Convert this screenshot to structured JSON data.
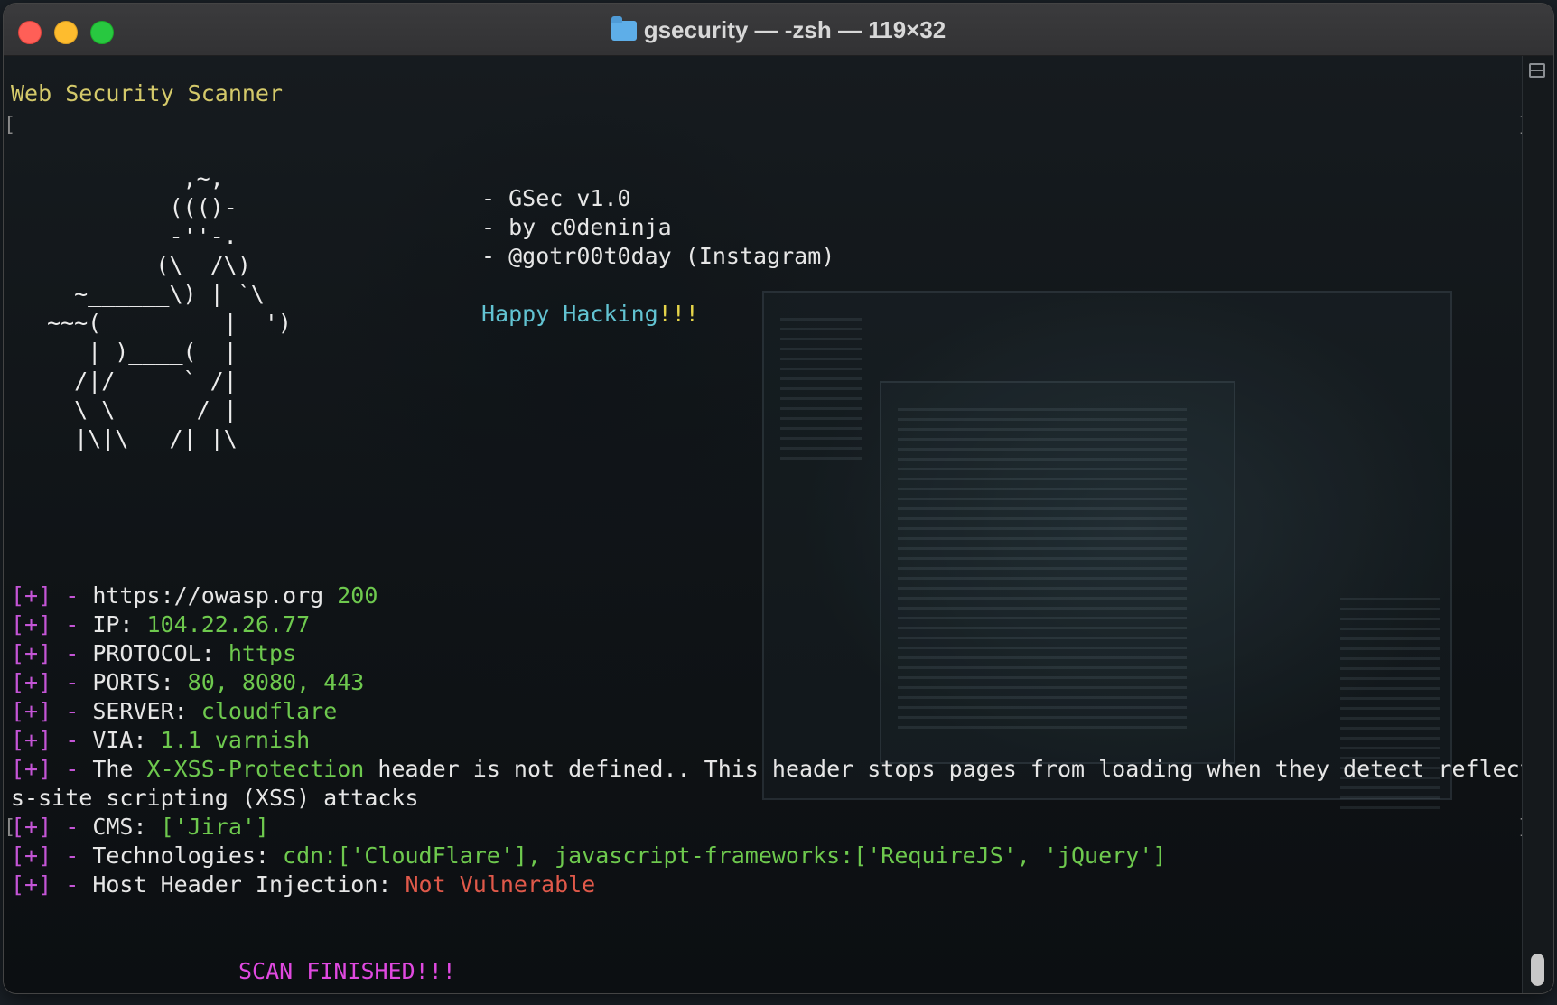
{
  "window": {
    "title": "gsecurity — -zsh — 119×32"
  },
  "terminal": {
    "header": "Web Security Scanner",
    "ascii_art": "          ,~,\n         ((()-\n         -''-.\n        (\\  /\\)\n  ~______\\) | `\\\n~~~(         |  ')\n   | )____(  |\n  /|/     ` /|\n  \\ \\      / |\n  |\\|\\   /| |\\",
    "info": [
      "- GSec v1.0",
      "- by c0deninja",
      "- @gotr00t0day (Instagram)"
    ],
    "happy": {
      "text": "Happy Hacking",
      "bang": "!!!"
    },
    "results": {
      "marker": "[+]",
      "dash": " - ",
      "url": "https://owasp.org",
      "url_status": "200",
      "ip_label": "IP: ",
      "ip_value": "104.22.26.77",
      "protocol_label": "PROTOCOL: ",
      "protocol_value": "https",
      "ports_label": "PORTS: ",
      "ports_value": "80, 8080, 443",
      "server_label": "SERVER: ",
      "server_value": "cloudflare",
      "via_label": "VIA: ",
      "via_value": "1.1 varnish",
      "xss_pre": "The ",
      "xss_header": "X-XSS-Protection",
      "xss_post": " header is not defined.. This header stops pages from loading when they detect reflected cros",
      "xss_cont": "s-site scripting (XSS) attacks",
      "cms_label": "CMS: ",
      "cms_value": "['Jira']",
      "tech_label": "Technologies: ",
      "tech_value": "cdn:['CloudFlare'], javascript-frameworks:['RequireJS', 'jQuery']",
      "hhi_label": "Host Header Injection: ",
      "hhi_value": "Not Vulnerable"
    },
    "finished": "SCAN FINISHED!!!"
  },
  "colors": {
    "marker": "#c455d6",
    "value": "#6ec94e",
    "header": "#d4c96a",
    "happy": "#62c3d2",
    "alert": "#e0594a",
    "finished": "#e049e0"
  },
  "icons": [
    "folder-icon",
    "scrollbar-toggle-icon"
  ]
}
